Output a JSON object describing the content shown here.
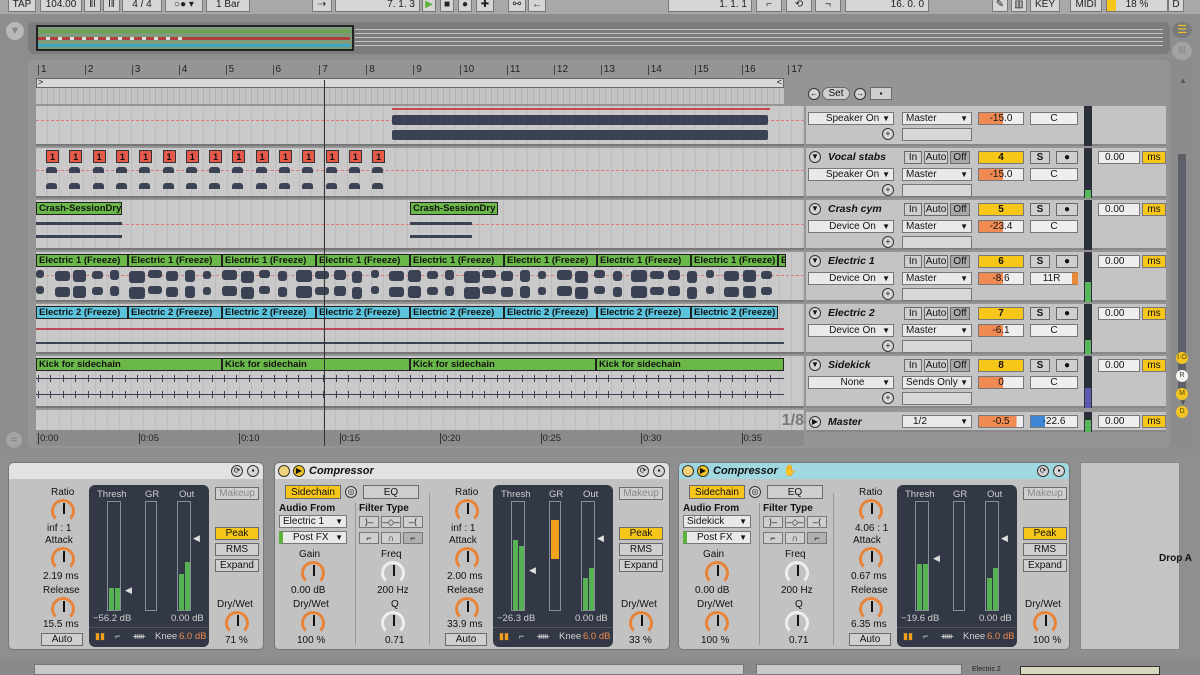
{
  "transport": {
    "tap": "TAP",
    "tempo": "104.00",
    "time_sig": "4 / 4",
    "quantize": "1 Bar",
    "position": "7.  1.  3",
    "loop_start": "1.  1.  1",
    "loop_length": "16.  0.  0",
    "key": "KEY",
    "midi": "MIDI",
    "cpu": "18 %",
    "disk": "D"
  },
  "ruler": {
    "bars": [
      "1",
      "2",
      "3",
      "4",
      "5",
      "6",
      "7",
      "8",
      "9",
      "10",
      "11",
      "12",
      "13",
      "14",
      "15",
      "16",
      "17"
    ],
    "time_ticks": [
      "0:00",
      "0:05",
      "0:10",
      "0:15",
      "0:20",
      "0:25",
      "0:30",
      "0:35"
    ],
    "zoom_fraction": "1/8"
  },
  "locator": {
    "set": "Set"
  },
  "tracks": [
    {
      "name": "",
      "device_state": "Speaker On",
      "output": "Master",
      "volume": "-15.0",
      "pan": "C"
    },
    {
      "name": "Vocal stabs",
      "number": "4",
      "device_state": "Speaker On",
      "output": "Master",
      "volume": "-15.0",
      "pan": "C",
      "delay": "0.00",
      "delay_unit": "ms"
    },
    {
      "name": "Crash cym",
      "number": "5",
      "device_state": "Device On",
      "output": "Master",
      "volume": "-23.4",
      "pan": "C",
      "delay": "0.00",
      "delay_unit": "ms",
      "clip": "Crash-SessionDry"
    },
    {
      "name": "Electric 1",
      "number": "6",
      "device_state": "Device On",
      "output": "Master",
      "volume": "-8.6",
      "pan": "11R",
      "delay": "0.00",
      "delay_unit": "ms",
      "clip": "Electric 1 (Freeze)"
    },
    {
      "name": "Electric 2",
      "number": "7",
      "device_state": "Device On",
      "output": "Master",
      "volume": "-6.1",
      "pan": "C",
      "delay": "0.00",
      "delay_unit": "ms",
      "clip": "Electric 2 (Freeze)"
    },
    {
      "name": "Sidekick",
      "number": "8",
      "device_state": "None",
      "output": "Sends Only",
      "volume": "0",
      "pan": "C",
      "delay": "0.00",
      "delay_unit": "ms",
      "clip": "Kick for sidechain"
    }
  ],
  "master": {
    "name": "Master",
    "cue": "1/2",
    "volume": "-0.5",
    "cue_volume": "-22.6",
    "delay": "0.00",
    "delay_unit": "ms"
  },
  "monitor": {
    "in": "In",
    "auto": "Auto",
    "off": "Off",
    "solo": "S",
    "arm": "●"
  },
  "midi_note_label": "1",
  "right_indicators": [
    "I·O",
    "R",
    "M",
    "D"
  ],
  "devices": [
    {
      "title": "",
      "ratio": "inf : 1",
      "attack": "2.19 ms",
      "release": "15.5 ms",
      "auto": "Auto",
      "thresh_value": "−56.2 dB",
      "out_value": "0.00 dB",
      "knee": "6.0 dB",
      "drywet": "71 %",
      "gr_fill": 0
    },
    {
      "title": "Compressor",
      "sidechain": "Sidechain",
      "eq": "EQ",
      "audio_from_label": "Audio From",
      "audio_from": "Electric 1",
      "tap": "Post FX",
      "gain_label": "Gain",
      "gain": "0.00 dB",
      "sc_drywet_label": "Dry/Wet",
      "sc_drywet": "100 %",
      "filter_type_label": "Filter Type",
      "freq_label": "Freq",
      "freq": "200 Hz",
      "q_label": "Q",
      "q": "0.71",
      "ratio": "inf : 1",
      "attack": "2.00 ms",
      "release": "33.9 ms",
      "auto": "Auto",
      "thresh_value": "−26.3 dB",
      "out_value": "0.00 dB",
      "knee": "6.0 dB",
      "drywet": "33 %",
      "gr_fill": 0.35
    },
    {
      "title": "Compressor",
      "sidechain": "Sidechain",
      "eq": "EQ",
      "audio_from_label": "Audio From",
      "audio_from": "Sidekick",
      "tap": "Post FX",
      "gain_label": "Gain",
      "gain": "0.00 dB",
      "sc_drywet_label": "Dry/Wet",
      "sc_drywet": "100 %",
      "filter_type_label": "Filter Type",
      "freq_label": "Freq",
      "freq": "200 Hz",
      "q_label": "Q",
      "q": "0.71",
      "ratio": "4.06 : 1",
      "attack": "0.67 ms",
      "release": "6.35 ms",
      "auto": "Auto",
      "thresh_value": "−19.6 dB",
      "out_value": "0.00 dB",
      "knee": "6.0 dB",
      "drywet": "100 %",
      "gr_fill": 0
    }
  ],
  "labels": {
    "ratio": "Ratio",
    "attack": "Attack",
    "release": "Release",
    "thresh": "Thresh",
    "gr": "GR",
    "out": "Out",
    "makeup": "Makeup",
    "peak": "Peak",
    "rms": "RMS",
    "expand": "Expand",
    "drywet": "Dry/Wet",
    "knee": "Knee"
  },
  "drop_area": "Drop A",
  "bottom_track": "Electric 2"
}
